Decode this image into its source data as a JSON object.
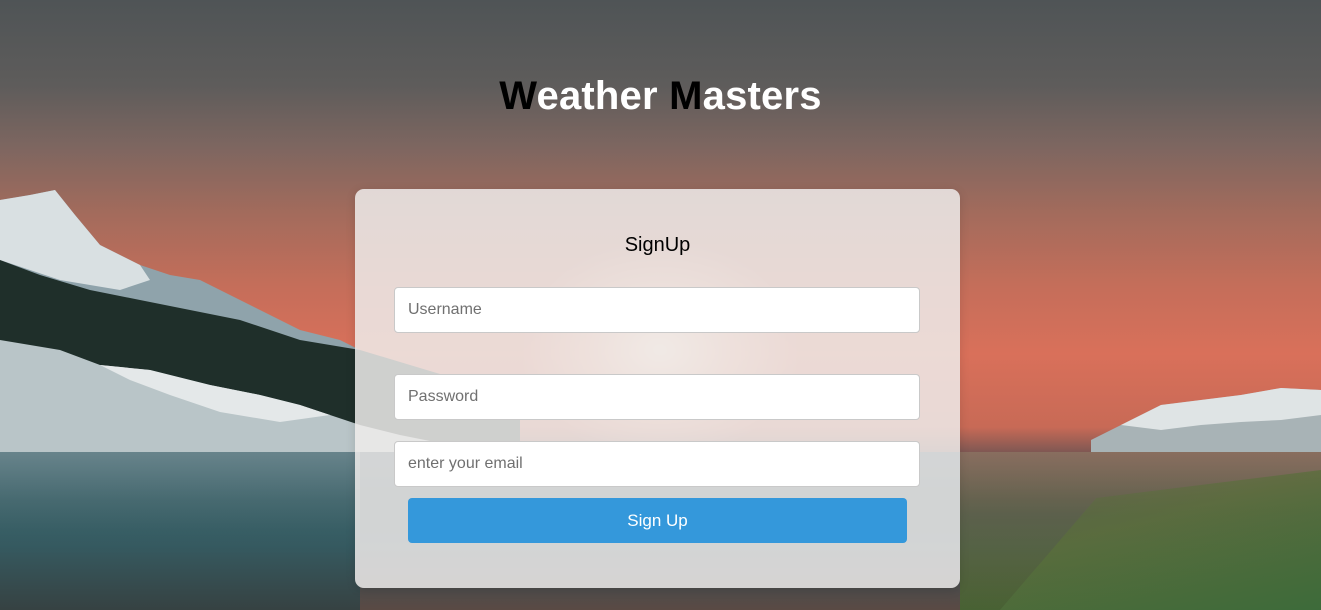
{
  "page": {
    "title_first_cap": "W",
    "title_first_rest": "eather ",
    "title_second_cap": "M",
    "title_second_rest": "asters"
  },
  "signup": {
    "heading": "SignUp",
    "username_placeholder": "Username",
    "password_placeholder": "Password",
    "email_placeholder": "enter your email",
    "submit_label": "Sign Up"
  },
  "colors": {
    "button": "#3498db",
    "title_text": "#ffffff",
    "title_initials": "#000000"
  }
}
